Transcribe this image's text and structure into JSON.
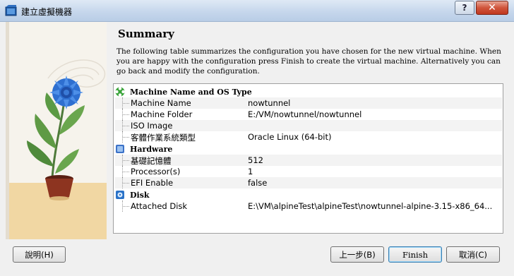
{
  "window": {
    "title": "建立虛擬機器",
    "help_label": "?",
    "close_label": "✕",
    "icon": "virtualbox-icon"
  },
  "page": {
    "heading": "Summary",
    "description": "The following table summarizes the configuration you have chosen for the new virtual machine. When you are happy with the configuration press Finish to create the virtual machine. Alternatively you can go back and modify the configuration."
  },
  "summary": {
    "name_os": {
      "label": "Machine Name and OS Type",
      "icon": "puzzle-icon",
      "rows": [
        {
          "key": "Machine Name",
          "value": "nowtunnel"
        },
        {
          "key": "Machine Folder",
          "value": "E:/VM/nowtunnel/nowtunnel"
        },
        {
          "key": "ISO Image",
          "value": ""
        },
        {
          "key": "客體作業系統類型",
          "value": "Oracle Linux (64-bit)"
        }
      ]
    },
    "hardware": {
      "label": "Hardware",
      "icon": "chip-icon",
      "rows": [
        {
          "key": "基礎記憶體",
          "value": "512"
        },
        {
          "key": "Processor(s)",
          "value": "1"
        },
        {
          "key": "EFI Enable",
          "value": "false"
        }
      ]
    },
    "disk": {
      "label": "Disk",
      "icon": "disk-icon",
      "rows": [
        {
          "key": "Attached Disk",
          "value": "E:\\VM\\alpineTest\\alpineTest\\nowtunnel-alpine-3.15-x86_64..."
        }
      ]
    }
  },
  "buttons": {
    "help": "說明(H)",
    "back": "上一步(B)",
    "finish": "Finish",
    "cancel": "取消(C)"
  },
  "colors": {
    "titlebar": "#c6d7ec",
    "close_button": "#c0381f",
    "section_green": "#3aa33a",
    "section_blue": "#3c72c8"
  }
}
